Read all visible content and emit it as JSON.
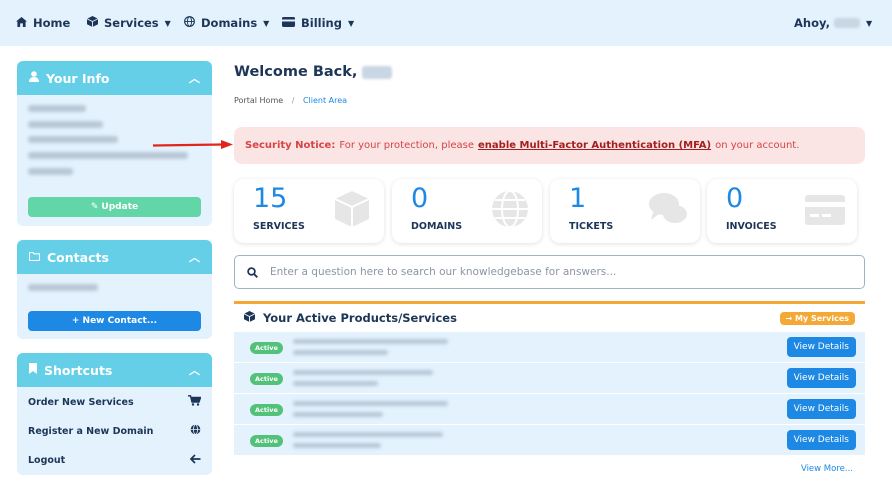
{
  "nav": {
    "home": "Home",
    "services": "Services",
    "domains": "Domains",
    "billing": "Billing",
    "greeting": "Ahoy,"
  },
  "sidebar": {
    "your_info": {
      "title": "Your Info",
      "update_label": "Update"
    },
    "contacts": {
      "title": "Contacts",
      "new_contact_label": "+ New Contact..."
    },
    "shortcuts": {
      "title": "Shortcuts",
      "items": [
        {
          "label": "Order New Services",
          "icon": "cart-icon"
        },
        {
          "label": "Register a New Domain",
          "icon": "globe-icon"
        },
        {
          "label": "Logout",
          "icon": "arrow-left-icon"
        }
      ]
    }
  },
  "main": {
    "welcome": "Welcome Back,",
    "breadcrumb": {
      "home": "Portal Home",
      "separator": "/",
      "current": "Client Area"
    },
    "notice": {
      "prefix": "Security Notice:",
      "text_before": "For your protection, please",
      "link": "enable Multi-Factor Authentication (MFA)",
      "text_after": "on your account."
    },
    "stats": [
      {
        "value": "15",
        "label": "SERVICES",
        "icon": "cube-icon"
      },
      {
        "value": "0",
        "label": "DOMAINS",
        "icon": "globe-icon"
      },
      {
        "value": "1",
        "label": "TICKETS",
        "icon": "chat-icon"
      },
      {
        "value": "0",
        "label": "INVOICES",
        "icon": "credit-card-icon"
      }
    ],
    "kb_placeholder": "Enter a question here to search our knowledgebase for answers...",
    "products": {
      "title": "Your Active Products/Services",
      "my_services": "→ My Services",
      "rows": [
        {
          "status": "Active",
          "button": "View Details"
        },
        {
          "status": "Active",
          "button": "View Details"
        },
        {
          "status": "Active",
          "button": "View Details"
        },
        {
          "status": "Active",
          "button": "View Details"
        }
      ],
      "view_more": "View More..."
    }
  },
  "colors": {
    "accent": "#1e88e5",
    "panel_header": "#64cfe7",
    "panel_bg": "#e3f2fd",
    "active_badge": "#52c27b",
    "notice_bg": "#fbe4e4",
    "notice_text": "#d84343",
    "products_accent": "#f4a937"
  }
}
